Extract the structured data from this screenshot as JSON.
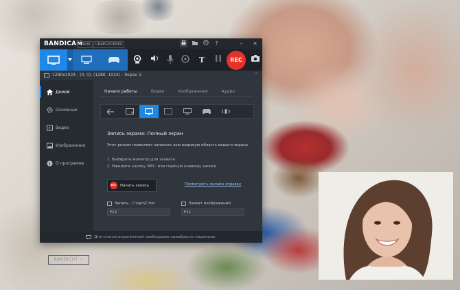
{
  "app": {
    "name": "BANDICAM",
    "badges": [
      "ADMIN",
      "UNREGISTERED"
    ],
    "titlebar_icons": [
      "lock-icon",
      "folder-icon",
      "clock-icon",
      "help-icon",
      "minimize-icon",
      "close-icon"
    ]
  },
  "modes": [
    "screen-mode",
    "game-record-mode",
    "gamepad-mode"
  ],
  "tools": [
    "webcam-icon",
    "speaker-icon",
    "microphone-icon",
    "mouse-icon",
    "text-icon",
    "pause-icon"
  ],
  "rec_label": "REC",
  "area": "1280x1024 - (0, 0), (1280, 1024) - Экран 1",
  "sidebar": {
    "items": [
      {
        "label": "Домой",
        "icon": "home-icon"
      },
      {
        "label": "Основные",
        "icon": "gear-icon"
      },
      {
        "label": "Видео",
        "icon": "video-icon"
      },
      {
        "label": "Изображения",
        "icon": "image-icon"
      },
      {
        "label": "О программе",
        "icon": "info-icon"
      }
    ],
    "bandicut": "BANDICUT ↗"
  },
  "main": {
    "tabs": [
      "Начало работы",
      "Видео",
      "Изображения",
      "Аудио"
    ],
    "section_title": "Запись экрана: Полный экран",
    "description": "Этот режим позволяет записать всю видимую область вашего экрана",
    "step1": "1. Выберите монитор для захвата",
    "step2": "2. Нажмите кнопку 'REC' или горячую клавишу записи",
    "start_button": "Начать запись",
    "rec_mini": "REC",
    "help_link": "Посмотреть онлайн справку",
    "hotkey_record_label": "Запись - Старт/Стоп",
    "hotkey_record_value": "F12",
    "hotkey_capture_label": "Захват изображений",
    "hotkey_capture_value": "F11"
  },
  "status": "Для снятия ограничений необходимо приобрести лицензию.",
  "colors": {
    "accent": "#1f87e8",
    "rec": "#e8312b",
    "window_bg": "#2b3038"
  }
}
